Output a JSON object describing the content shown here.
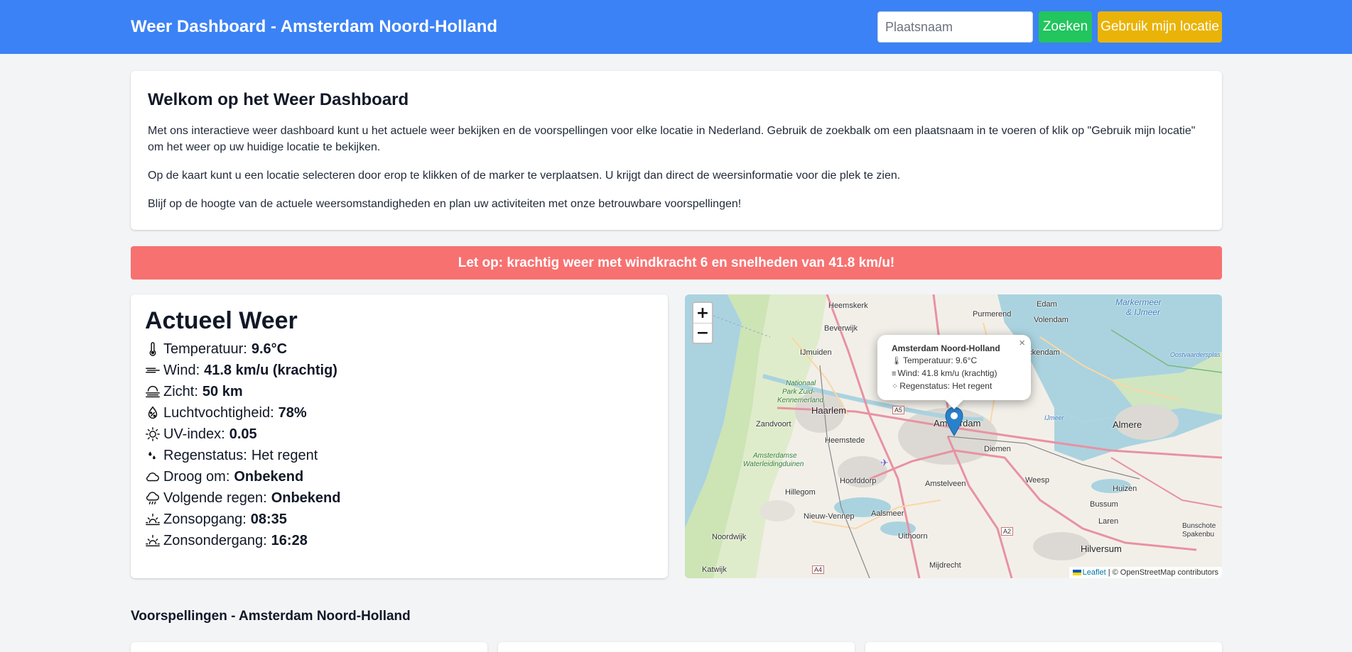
{
  "header": {
    "title": "Weer Dashboard - Amsterdam Noord-Holland",
    "search_placeholder": "Plaatsnaam",
    "search_value": "",
    "search_button": "Zoeken",
    "location_button": "Gebruik mijn locatie"
  },
  "intro": {
    "title": "Welkom op het Weer Dashboard",
    "paragraphs": [
      "Met ons interactieve weer dashboard kunt u het actuele weer bekijken en de voorspellingen voor elke locatie in Nederland. Gebruik de zoekbalk om een plaatsnaam in te voeren of klik op \"Gebruik mijn locatie\" om het weer op uw huidige locatie te bekijken.",
      "Op de kaart kunt u een locatie selecteren door erop te klikken of de marker te verplaatsen. U krijgt dan direct de weersinformatie voor die plek te zien.",
      "Blijf op de hoogte van de actuele weersomstandigheden en plan uw activiteiten met onze betrouwbare voorspellingen!"
    ]
  },
  "alert": {
    "text": "Let op: krachtig weer met windkracht 6 en snelheden van 41.8 km/u!",
    "color": "#f87171"
  },
  "current": {
    "title": "Actueel Weer",
    "rows": [
      {
        "icon": "thermometer-icon",
        "label": "Temperatuur:",
        "value": "9.6°C"
      },
      {
        "icon": "wind-icon",
        "label": "Wind:",
        "value": "41.8 km/u (krachtig)"
      },
      {
        "icon": "fog-icon",
        "label": "Zicht:",
        "value": "50 km"
      },
      {
        "icon": "humidity-icon",
        "label": "Luchtvochtigheid:",
        "value": "78%"
      },
      {
        "icon": "sun-icon",
        "label": "UV-index:",
        "value": "0.05"
      },
      {
        "icon": "raindrops-icon",
        "label": "Regenstatus:",
        "value": "Het regent"
      },
      {
        "icon": "cloud-icon",
        "label": "Droog om:",
        "value": "Onbekend"
      },
      {
        "icon": "cloud-rain-icon",
        "label": "Volgende regen:",
        "value": "Onbekend"
      },
      {
        "icon": "sunrise-icon",
        "label": "Zonsopgang:",
        "value": "08:35"
      },
      {
        "icon": "sunset-icon",
        "label": "Zonsondergang:",
        "value": "16:28"
      }
    ]
  },
  "map": {
    "zoom_in": "+",
    "zoom_out": "−",
    "popup": {
      "title": "Amsterdam Noord-Holland",
      "temperature": "Temperatuur: 9.6°C",
      "wind": "Wind: 41.8 km/u (krachtig)",
      "rain": "Regenstatus: Het regent",
      "close": "×"
    },
    "attribution_leaflet": "Leaflet",
    "attribution_rest": "| © OpenStreetMap contributors",
    "labels": {
      "heemskerk": "Heemskerk",
      "edam": "Edam",
      "markermeer": "Markermeer",
      "ijmeer_amp": "& IJmeer",
      "beverwijk": "Beverwijk",
      "purmerend": "Purmerend",
      "volendam": "Volendam",
      "ijmuiden": "IJmuiden",
      "nationaal_park_1": "Nationaal",
      "nationaal_park_2": "Park Zuid-",
      "nationaal_park_3": "Kennemerland",
      "haarlem": "Haarlem",
      "amsterdam": "Amsterdam",
      "zandvoort": "Zandvoort",
      "heemstede": "Heemstede",
      "diemen": "Diemen",
      "almere": "Almere",
      "waterleiding_1": "Amsterdamse",
      "waterleiding_2": "Waterleidingduinen",
      "hoofddorp": "Hoofddorp",
      "weesp": "Weesp",
      "hillegom": "Hillegom",
      "amstelveen": "Amstelveen",
      "huizen": "Huizen",
      "nieuw_vennep": "Nieuw-Vennep",
      "aalsmeer": "Aalsmeer",
      "bussum": "Bussum",
      "laren": "Laren",
      "noordwijk": "Noordwijk",
      "uithoorn": "Uithoorn",
      "hilversum": "Hilversum",
      "katwijk": "Katwijk",
      "mijdrecht": "Mijdrecht",
      "bunschoten": "Bunschote",
      "spakenburg": "Spakenbu",
      "oostvaardersplas": "Oostvaardersplas",
      "ijmeer": "IJmeer",
      "a5": "A5",
      "a2": "A2",
      "a4": "A4",
      "rickendam": "rickendam"
    }
  },
  "forecast": {
    "title": "Voorspellingen - Amsterdam Noord-Holland"
  }
}
